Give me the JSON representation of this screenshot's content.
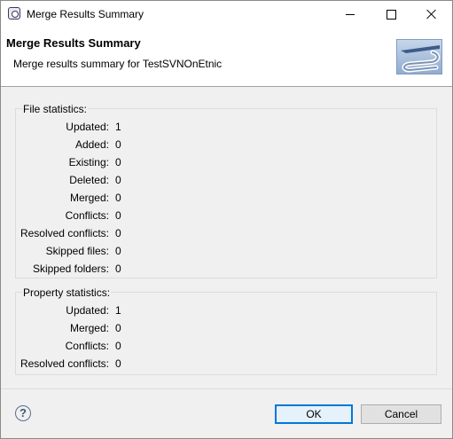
{
  "window": {
    "title": "Merge Results Summary",
    "icon": "eclipse-dialog-icon"
  },
  "banner": {
    "title": "Merge Results Summary",
    "subtitle": "Merge results summary for TestSVNOnEtnic",
    "logo": "svn-logo"
  },
  "file_stats": {
    "label": "File statistics:",
    "rows": [
      {
        "label": "Updated:",
        "value": "1"
      },
      {
        "label": "Added:",
        "value": "0"
      },
      {
        "label": "Existing:",
        "value": "0"
      },
      {
        "label": "Deleted:",
        "value": "0"
      },
      {
        "label": "Merged:",
        "value": "0"
      },
      {
        "label": "Conflicts:",
        "value": "0"
      },
      {
        "label": "Resolved conflicts:",
        "value": "0"
      },
      {
        "label": "Skipped files:",
        "value": "0"
      },
      {
        "label": "Skipped folders:",
        "value": "0"
      }
    ]
  },
  "prop_stats": {
    "label": "Property statistics:",
    "rows": [
      {
        "label": "Updated:",
        "value": "1"
      },
      {
        "label": "Merged:",
        "value": "0"
      },
      {
        "label": "Conflicts:",
        "value": "0"
      },
      {
        "label": "Resolved conflicts:",
        "value": "0"
      }
    ]
  },
  "buttons": {
    "ok": "OK",
    "cancel": "Cancel",
    "help": "?"
  }
}
